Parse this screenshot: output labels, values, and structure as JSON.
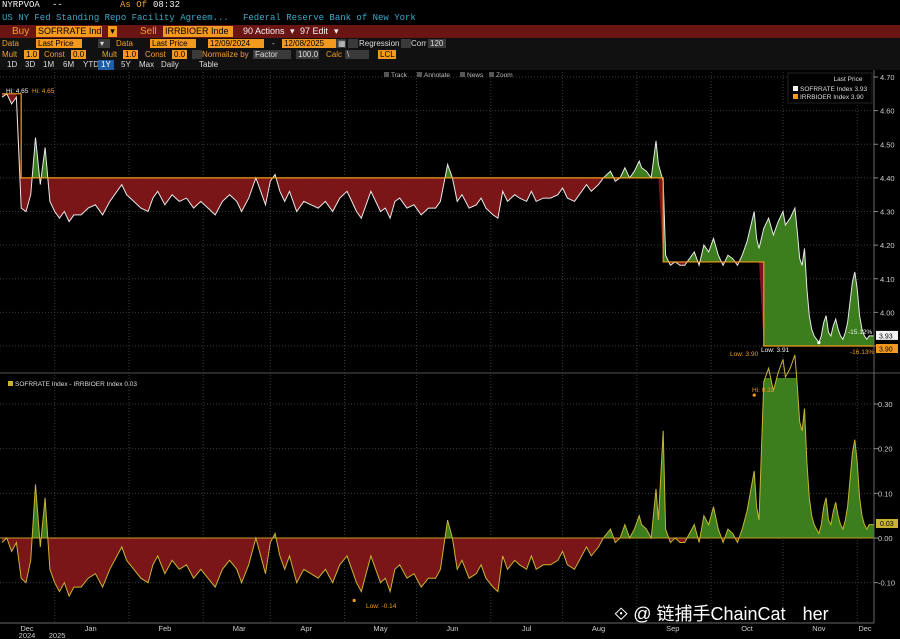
{
  "header": {
    "ticker": "NYRPVOA",
    "dashes": "--",
    "as_of_label": "As Of",
    "as_of_time": "08:32",
    "description": "US NY Fed Standing Repo Facility Agreem...",
    "source": "Federal Reserve Bank of New York"
  },
  "actionbar": {
    "buy_label": "Buy",
    "buy_security": "SOFRRATE Ind",
    "sell_label": "Sell",
    "sell_security": "IRRBIOER Inde",
    "actions_label": "90 Actions",
    "edit_label": "97 Edit"
  },
  "controls": {
    "data_label": "Data",
    "data1_value": "Last Price",
    "data2_label": "Data",
    "data2_value": "Last Price",
    "start_date": "12/09/2024",
    "date_sep": "-",
    "end_date": "12/08/2025",
    "regression_label": "Regression",
    "corr_label": "Corr",
    "corr_value": "120",
    "mult_label": "Mult",
    "mult_value": "1.0",
    "const_label": "Const",
    "const_value": "0.0",
    "mult2_label": "Mult",
    "mult2_value": "1.0",
    "const2_label": "Const",
    "const2_value": "0.0",
    "normalize_label": "Normalize by",
    "normalize_value": "Factor",
    "normalize_num": "100.0",
    "calc_label": "Calc",
    "calc_value": "\\",
    "lcl_value": "LCL"
  },
  "ranges": [
    "1D",
    "3D",
    "1M",
    "6M",
    "YTD",
    "1Y",
    "5Y",
    "Max",
    "Daily",
    "Table"
  ],
  "selected_range": "1Y",
  "chart_tools": [
    "Track",
    "Annotate",
    "News",
    "Zoom"
  ],
  "chart_data": [
    {
      "type": "area",
      "legend_title": "Last Price",
      "series": [
        {
          "name": "SOFRRATE Index",
          "last": "3.93",
          "color": "#f2f2f2"
        },
        {
          "name": "IRRBIOER Index",
          "last": "3.90",
          "color": "#f39a1e"
        }
      ],
      "x_tick_labels": [
        "Dec",
        "Jan",
        "Feb",
        "Mar",
        "Apr",
        "May",
        "Jun",
        "Jul",
        "Aug",
        "Sep",
        "Oct",
        "Nov",
        "Dec"
      ],
      "x_year_labels": [
        "2024",
        "2025"
      ],
      "y_ticks": [
        "4.70",
        "4.60",
        "4.50",
        "4.40",
        "4.30",
        "4.20",
        "4.10",
        "4.00",
        "3.90"
      ],
      "ylim": [
        3.855,
        4.705
      ],
      "annotations": {
        "hi_sofr": "Hi: 4.65",
        "hi_ioer": "Hi: 4.65",
        "low_ioer": "Low: 3.90",
        "low_sofr": "Low: 3.91",
        "pct_sofr": "-15.12%",
        "pct_ioer": "-16.13%"
      },
      "ioer_steps": [
        {
          "from_day": 0,
          "to_day": 8,
          "value": 4.65
        },
        {
          "from_day": 8,
          "to_day": 276,
          "value": 4.4
        },
        {
          "from_day": 276,
          "to_day": 318,
          "value": 4.15
        },
        {
          "from_day": 318,
          "to_day": 364,
          "value": 3.9
        }
      ],
      "sofr_points": [
        [
          0,
          4.64
        ],
        [
          2,
          4.65
        ],
        [
          4,
          4.62
        ],
        [
          6,
          4.64
        ],
        [
          8,
          4.31
        ],
        [
          10,
          4.3
        ],
        [
          12,
          4.35
        ],
        [
          14,
          4.52
        ],
        [
          16,
          4.38
        ],
        [
          18,
          4.49
        ],
        [
          20,
          4.33
        ],
        [
          22,
          4.3
        ],
        [
          24,
          4.28
        ],
        [
          26,
          4.3
        ],
        [
          28,
          4.27
        ],
        [
          30,
          4.29
        ],
        [
          33,
          4.29
        ],
        [
          36,
          4.31
        ],
        [
          39,
          4.32
        ],
        [
          42,
          4.29
        ],
        [
          45,
          4.33
        ],
        [
          48,
          4.36
        ],
        [
          50,
          4.38
        ],
        [
          52,
          4.35
        ],
        [
          55,
          4.33
        ],
        [
          58,
          4.31
        ],
        [
          61,
          4.3
        ],
        [
          63,
          4.34
        ],
        [
          65,
          4.36
        ],
        [
          68,
          4.32
        ],
        [
          71,
          4.35
        ],
        [
          74,
          4.33
        ],
        [
          77,
          4.34
        ],
        [
          80,
          4.31
        ],
        [
          83,
          4.33
        ],
        [
          86,
          4.31
        ],
        [
          89,
          4.29
        ],
        [
          92,
          4.33
        ],
        [
          95,
          4.35
        ],
        [
          98,
          4.33
        ],
        [
          100,
          4.3
        ],
        [
          103,
          4.34
        ],
        [
          106,
          4.4
        ],
        [
          108,
          4.36
        ],
        [
          110,
          4.32
        ],
        [
          112,
          4.39
        ],
        [
          114,
          4.41
        ],
        [
          116,
          4.36
        ],
        [
          118,
          4.33
        ],
        [
          120,
          4.36
        ],
        [
          123,
          4.3
        ],
        [
          126,
          4.33
        ],
        [
          129,
          4.32
        ],
        [
          132,
          4.31
        ],
        [
          135,
          4.33
        ],
        [
          138,
          4.3
        ],
        [
          141,
          4.34
        ],
        [
          144,
          4.36
        ],
        [
          146,
          4.33
        ],
        [
          148,
          4.3
        ],
        [
          150,
          4.28
        ],
        [
          152,
          4.32
        ],
        [
          154,
          4.36
        ],
        [
          156,
          4.33
        ],
        [
          158,
          4.3
        ],
        [
          160,
          4.31
        ],
        [
          162,
          4.28
        ],
        [
          164,
          4.33
        ],
        [
          166,
          4.34
        ],
        [
          169,
          4.31
        ],
        [
          172,
          4.32
        ],
        [
          175,
          4.29
        ],
        [
          178,
          4.31
        ],
        [
          181,
          4.31
        ],
        [
          183,
          4.33
        ],
        [
          186,
          4.44
        ],
        [
          188,
          4.4
        ],
        [
          190,
          4.33
        ],
        [
          192,
          4.35
        ],
        [
          195,
          4.31
        ],
        [
          198,
          4.32
        ],
        [
          200,
          4.34
        ],
        [
          202,
          4.31
        ],
        [
          205,
          4.29
        ],
        [
          207,
          4.28
        ],
        [
          209,
          4.36
        ],
        [
          211,
          4.33
        ],
        [
          214,
          4.35
        ],
        [
          216,
          4.34
        ],
        [
          219,
          4.33
        ],
        [
          221,
          4.36
        ],
        [
          223,
          4.33
        ],
        [
          226,
          4.34
        ],
        [
          229,
          4.34
        ],
        [
          232,
          4.35
        ],
        [
          234,
          4.37
        ],
        [
          236,
          4.34
        ],
        [
          239,
          4.33
        ],
        [
          242,
          4.36
        ],
        [
          244,
          4.38
        ],
        [
          246,
          4.36
        ],
        [
          249,
          4.38
        ],
        [
          251,
          4.4
        ],
        [
          254,
          4.42
        ],
        [
          256,
          4.39
        ],
        [
          258,
          4.4
        ],
        [
          260,
          4.43
        ],
        [
          262,
          4.4
        ],
        [
          264,
          4.42
        ],
        [
          266,
          4.45
        ],
        [
          267,
          4.43
        ],
        [
          269,
          4.42
        ],
        [
          271,
          4.4
        ],
        [
          273,
          4.51
        ],
        [
          274,
          4.44
        ],
        [
          276,
          4.39
        ],
        [
          277,
          4.17
        ],
        [
          279,
          4.14
        ],
        [
          281,
          4.15
        ],
        [
          283,
          4.14
        ],
        [
          285,
          4.14
        ],
        [
          287,
          4.16
        ],
        [
          289,
          4.18
        ],
        [
          291,
          4.14
        ],
        [
          293,
          4.2
        ],
        [
          295,
          4.18
        ],
        [
          297,
          4.22
        ],
        [
          299,
          4.17
        ],
        [
          301,
          4.14
        ],
        [
          303,
          4.17
        ],
        [
          305,
          4.16
        ],
        [
          307,
          4.14
        ],
        [
          309,
          4.17
        ],
        [
          311,
          4.21
        ],
        [
          313,
          4.27
        ],
        [
          314,
          4.3
        ],
        [
          315,
          4.22
        ],
        [
          316,
          4.19
        ],
        [
          318,
          4.25
        ],
        [
          320,
          4.28
        ],
        [
          322,
          4.23
        ],
        [
          324,
          4.27
        ],
        [
          326,
          4.3
        ],
        [
          327,
          4.26
        ],
        [
          329,
          4.28
        ],
        [
          331,
          4.31
        ],
        [
          332,
          4.24
        ],
        [
          333,
          4.16
        ],
        [
          334,
          4.14
        ],
        [
          335,
          4.19
        ],
        [
          336,
          4.07
        ],
        [
          337,
          3.99
        ],
        [
          338,
          3.95
        ],
        [
          339,
          3.93
        ],
        [
          341,
          3.91
        ],
        [
          342,
          3.93
        ],
        [
          343,
          3.97
        ],
        [
          344,
          3.99
        ],
        [
          345,
          3.94
        ],
        [
          346,
          3.93
        ],
        [
          347,
          3.96
        ],
        [
          348,
          3.98
        ],
        [
          349,
          3.95
        ],
        [
          350,
          3.93
        ],
        [
          351,
          3.92
        ],
        [
          352,
          3.94
        ],
        [
          353,
          3.97
        ],
        [
          354,
          4.03
        ],
        [
          355,
          4.09
        ],
        [
          356,
          4.12
        ],
        [
          357,
          4.07
        ],
        [
          358,
          3.99
        ],
        [
          359,
          3.95
        ],
        [
          360,
          3.93
        ],
        [
          361,
          3.92
        ],
        [
          362,
          3.93
        ],
        [
          363,
          3.93
        ],
        [
          364,
          3.93
        ]
      ]
    },
    {
      "type": "area",
      "legend_label": "SOFRRATE Index - IRRBIOER Index 0.03",
      "series_name": "SOFRRATE Index - IRRBIOER Index",
      "derived_from": "difference of the two upper series",
      "y_ticks": [
        "0.30",
        "0.20",
        "0.10",
        "0.00",
        "-0.10"
      ],
      "ylim": [
        -0.175,
        0.36
      ],
      "annotations": {
        "hi": "Hi: 0.32",
        "low": "Low: -0.14",
        "last": "0.03"
      }
    }
  ],
  "watermark": {
    "text": "链捕手ChainCat",
    "suffix": "her"
  }
}
